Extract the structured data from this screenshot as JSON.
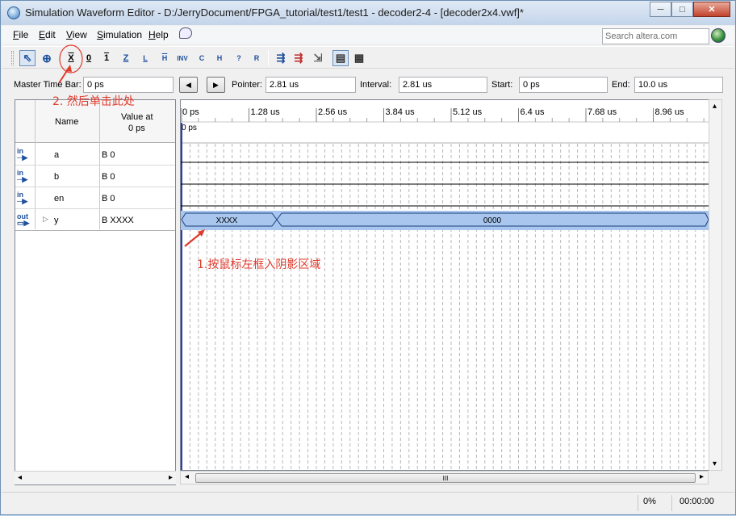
{
  "window": {
    "title": "Simulation Waveform Editor - D:/JerryDocument/FPGA_tutorial/test1/test1 - decoder2-4 - [decoder2x4.vwf]*",
    "minimize": "─",
    "maximize": "□",
    "close": "✕"
  },
  "menu": [
    {
      "accel": "F",
      "rest": "ile"
    },
    {
      "accel": "E",
      "rest": "dit"
    },
    {
      "accel": "V",
      "rest": "iew"
    },
    {
      "accel": "S",
      "rest": "imulation"
    },
    {
      "accel": "H",
      "rest": "elp"
    }
  ],
  "search_placeholder": "Search altera.com",
  "toolbar": {
    "selection_tool": "⇖",
    "zoom_tool": "⊕",
    "uninitialized": "X",
    "forcing_low": "0",
    "forcing_high": "1",
    "high_impedance": "Z",
    "weak_low": "L",
    "weak_high": "H",
    "invert": "INV",
    "count_value": "C",
    "dont_care": "?",
    "random": "R",
    "t1": "⇶",
    "t2": "⇶",
    "t3": "⇲",
    "t4": "▤",
    "t5": "▦"
  },
  "timebar": {
    "master_label": "Master Time Bar:",
    "master_value": "0 ps",
    "prev": "◀",
    "next": "▶",
    "pointer_label": "Pointer:",
    "pointer_value": "2.81 us",
    "interval_label": "Interval:",
    "interval_value": "2.81 us",
    "start_label": "Start:",
    "start_value": "0 ps",
    "end_label": "End:",
    "end_value": "10.0 us"
  },
  "signal_table": {
    "header_name": "Name",
    "header_value_l1": "Value at",
    "header_value_l2": "0 ps",
    "rows": [
      {
        "dir": "in",
        "name": "a",
        "value": "B 0"
      },
      {
        "dir": "in",
        "name": "b",
        "value": "B 0"
      },
      {
        "dir": "in",
        "name": "en",
        "value": "B 0"
      },
      {
        "dir": "out",
        "name": "y",
        "value": "B XXXX",
        "expand": "▷"
      }
    ]
  },
  "wave": {
    "time_ticks": [
      "0 ps",
      "1.28 us",
      "2.56 us",
      "3.84 us",
      "5.12 us",
      "6.4 us",
      "7.68 us",
      "8.96 us"
    ],
    "master_marker": "0 ps",
    "y_seg1": "XXXX",
    "y_seg2": "0000"
  },
  "scroll": {
    "left": "◂",
    "right": "▸",
    "up": "▴",
    "down": "▾",
    "grip": "III"
  },
  "status": {
    "progress": "0%",
    "elapsed": "00:00:00"
  },
  "annotations": {
    "step1": "1.按鼠标左框入阴影区域",
    "step2": "2. 然后单击此处"
  }
}
